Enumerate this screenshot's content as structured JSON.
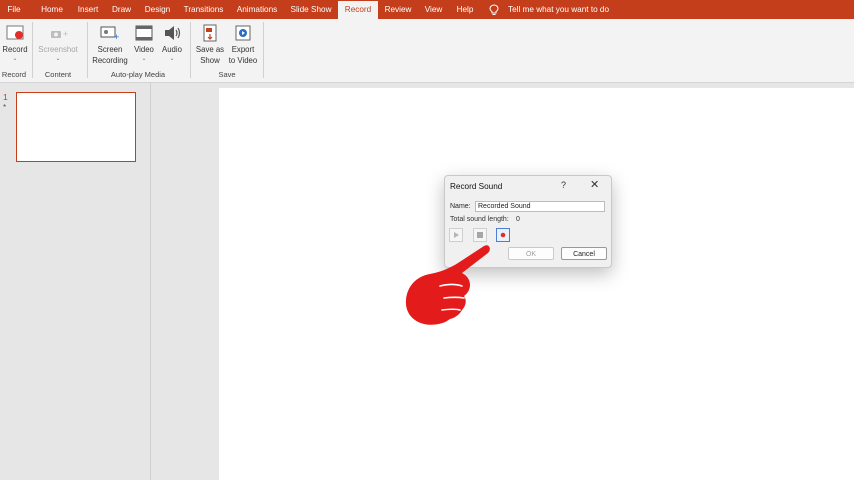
{
  "tabs": [
    {
      "label": "File"
    },
    {
      "label": "Home"
    },
    {
      "label": "Insert"
    },
    {
      "label": "Draw"
    },
    {
      "label": "Design"
    },
    {
      "label": "Transitions"
    },
    {
      "label": "Animations"
    },
    {
      "label": "Slide Show"
    },
    {
      "label": "Record"
    },
    {
      "label": "Review"
    },
    {
      "label": "View"
    },
    {
      "label": "Help"
    }
  ],
  "tell_me": "Tell me what you want to do",
  "ribbon": {
    "record_label": "Record",
    "screenshot_label": "Screenshot",
    "screen_recording_line1": "Screen",
    "screen_recording_line2": "Recording",
    "video_label": "Video",
    "audio_label": "Audio",
    "save_as_show_line1": "Save as",
    "save_as_show_line2": "Show",
    "export_line1": "Export",
    "export_line2": "to Video",
    "groups": {
      "record": "Record",
      "content": "Content",
      "autoplay": "Auto-play Media",
      "save": "Save"
    }
  },
  "slides": {
    "number": "1",
    "star": "*"
  },
  "dialog": {
    "title": "Record Sound",
    "help": "?",
    "close": "✕",
    "name_label": "Name:",
    "name_value": "Recorded Sound",
    "length_label": "Total sound length:",
    "length_value": "0",
    "ok_label": "OK",
    "cancel_label": "Cancel"
  },
  "colors": {
    "accent": "#c43e1c",
    "record_dot": "#e0302a",
    "hand": "#e31b1b"
  }
}
